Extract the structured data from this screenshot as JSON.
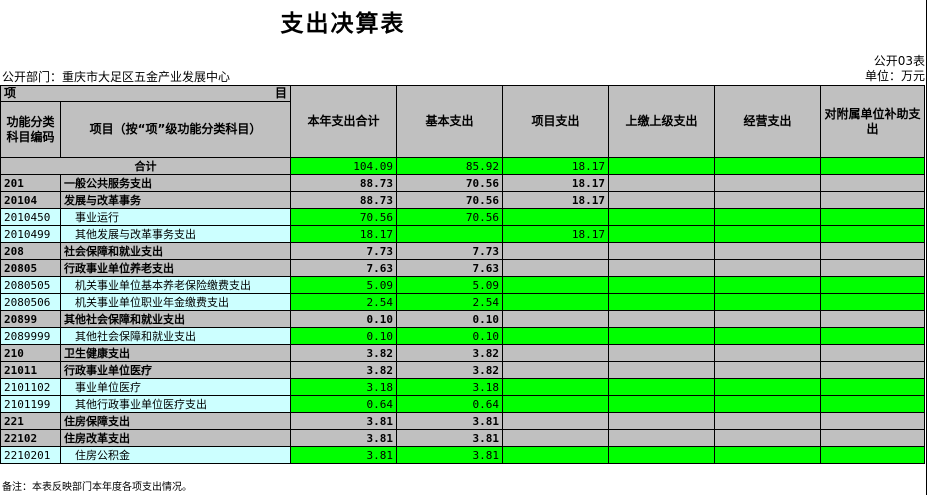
{
  "title": "支出决算表",
  "report_code": "公开03表",
  "unit": "单位：万元",
  "department": "公开部门：重庆市大足区五金产业发展中心",
  "header": {
    "corner_left": "项",
    "corner_right": "目",
    "code_col": "功能分类科目编码",
    "name_col": "项目（按“项”级功能分类科目）",
    "cols": [
      "本年支出合计",
      "基本支出",
      "项目支出",
      "上缴上级支出",
      "经营支出",
      "对附属单位补助支出"
    ]
  },
  "total": {
    "label": "合计",
    "values": [
      "104.09",
      "85.92",
      "18.17",
      "",
      "",
      ""
    ]
  },
  "rows": [
    {
      "code": "201",
      "name": "一般公共服务支出",
      "values": [
        "88.73",
        "70.56",
        "18.17",
        "",
        "",
        ""
      ],
      "level": 1
    },
    {
      "code": "20104",
      "name": "发展与改革事务",
      "values": [
        "88.73",
        "70.56",
        "18.17",
        "",
        "",
        ""
      ],
      "level": 2
    },
    {
      "code": "2010450",
      "name": "事业运行",
      "values": [
        "70.56",
        "70.56",
        "",
        "",
        "",
        ""
      ],
      "level": 3
    },
    {
      "code": "2010499",
      "name": "其他发展与改革事务支出",
      "values": [
        "18.17",
        "",
        "18.17",
        "",
        "",
        ""
      ],
      "level": 3
    },
    {
      "code": "208",
      "name": "社会保障和就业支出",
      "values": [
        "7.73",
        "7.73",
        "",
        "",
        "",
        ""
      ],
      "level": 1
    },
    {
      "code": "20805",
      "name": "行政事业单位养老支出",
      "values": [
        "7.63",
        "7.63",
        "",
        "",
        "",
        ""
      ],
      "level": 2
    },
    {
      "code": "2080505",
      "name": "机关事业单位基本养老保险缴费支出",
      "values": [
        "5.09",
        "5.09",
        "",
        "",
        "",
        ""
      ],
      "level": 3
    },
    {
      "code": "2080506",
      "name": "机关事业单位职业年金缴费支出",
      "values": [
        "2.54",
        "2.54",
        "",
        "",
        "",
        ""
      ],
      "level": 3
    },
    {
      "code": "20899",
      "name": "其他社会保障和就业支出",
      "values": [
        "0.10",
        "0.10",
        "",
        "",
        "",
        ""
      ],
      "level": 2
    },
    {
      "code": "2089999",
      "name": "其他社会保障和就业支出",
      "values": [
        "0.10",
        "0.10",
        "",
        "",
        "",
        ""
      ],
      "level": 3
    },
    {
      "code": "210",
      "name": "卫生健康支出",
      "values": [
        "3.82",
        "3.82",
        "",
        "",
        "",
        ""
      ],
      "level": 1
    },
    {
      "code": "21011",
      "name": "行政事业单位医疗",
      "values": [
        "3.82",
        "3.82",
        "",
        "",
        "",
        ""
      ],
      "level": 2
    },
    {
      "code": "2101102",
      "name": "事业单位医疗",
      "values": [
        "3.18",
        "3.18",
        "",
        "",
        "",
        ""
      ],
      "level": 3
    },
    {
      "code": "2101199",
      "name": "其他行政事业单位医疗支出",
      "values": [
        "0.64",
        "0.64",
        "",
        "",
        "",
        ""
      ],
      "level": 3
    },
    {
      "code": "221",
      "name": "住房保障支出",
      "values": [
        "3.81",
        "3.81",
        "",
        "",
        "",
        ""
      ],
      "level": 1
    },
    {
      "code": "22102",
      "name": "住房改革支出",
      "values": [
        "3.81",
        "3.81",
        "",
        "",
        "",
        ""
      ],
      "level": 2
    },
    {
      "code": "2210201",
      "name": "住房公积金",
      "values": [
        "3.81",
        "3.81",
        "",
        "",
        "",
        ""
      ],
      "level": 3
    }
  ],
  "footnote": "备注：本表反映部门本年度各项支出情况。",
  "colors": {
    "header_gray": "#c0c0c0",
    "value_green": "#00ff00",
    "detail_cyan": "#ccffff"
  }
}
